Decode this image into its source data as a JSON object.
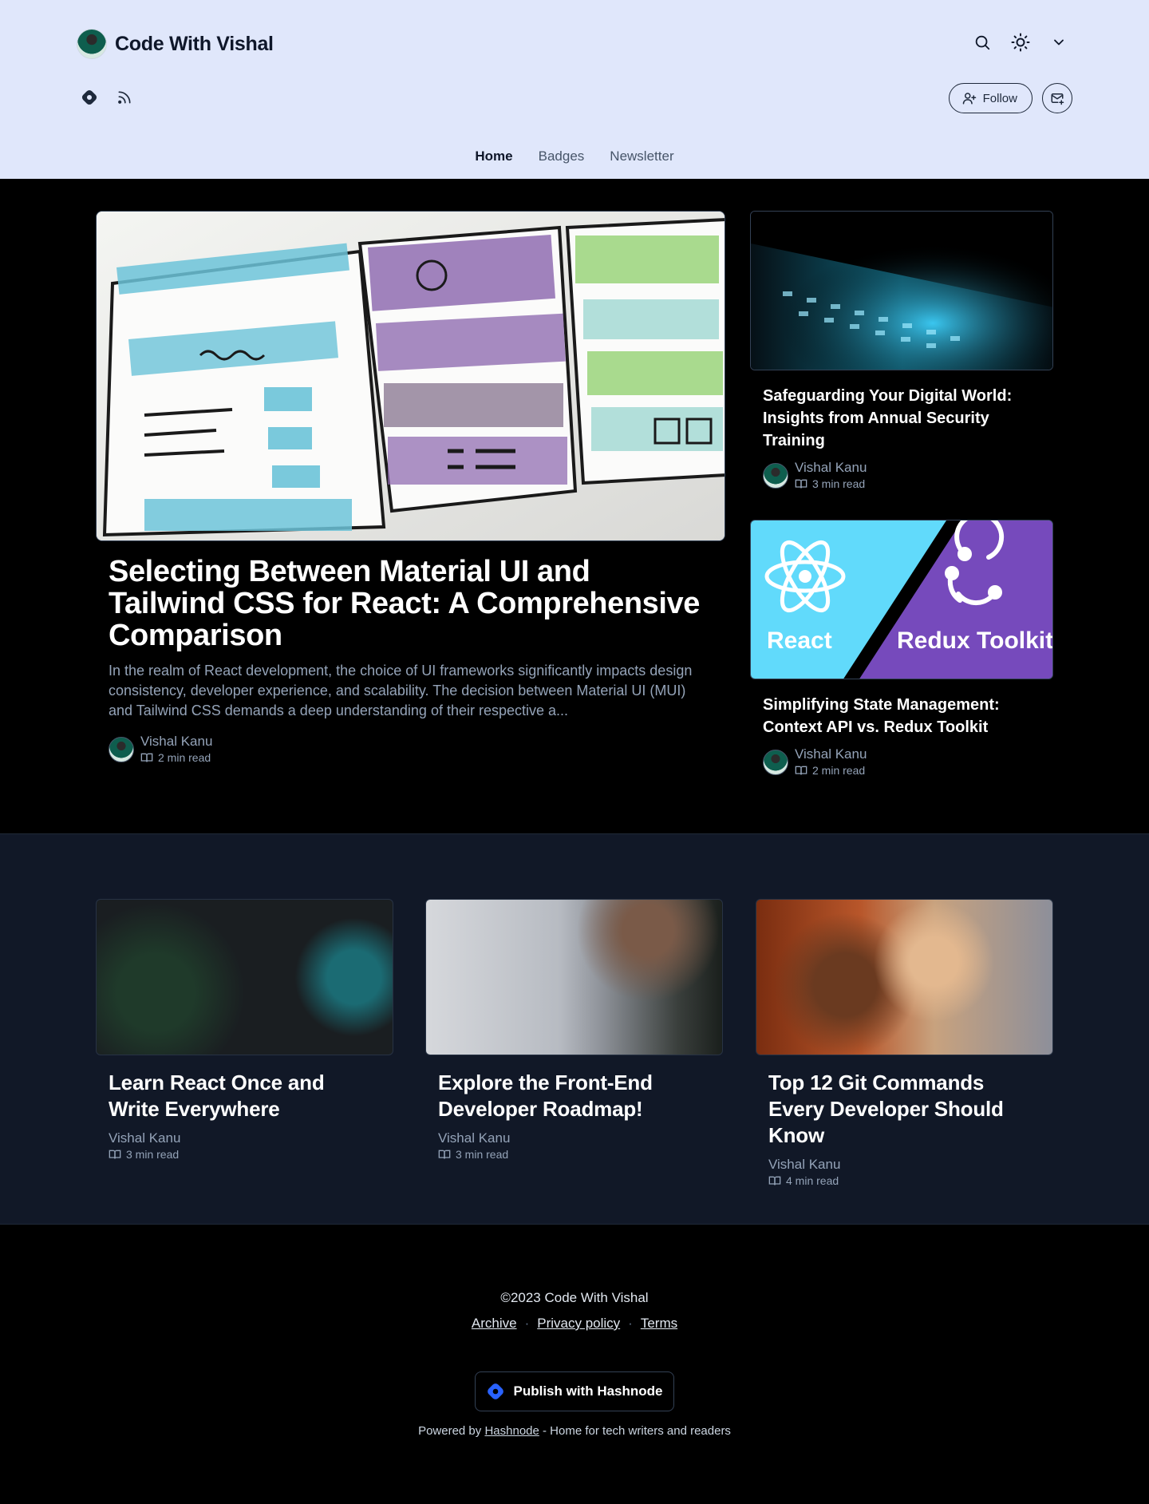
{
  "header": {
    "blog_name": "Code With Vishal",
    "actions": {
      "follow_label": "Follow"
    },
    "nav": [
      {
        "label": "Home",
        "active": true
      },
      {
        "label": "Badges",
        "active": false
      },
      {
        "label": "Newsletter",
        "active": false
      }
    ]
  },
  "featured": {
    "main": {
      "title": "Selecting Between Material UI and Tailwind CSS for React: A Comprehensive Comparison",
      "excerpt": "In the realm of React development, the choice of UI frameworks significantly impacts design consistency, developer experience, and scalability. The decision between Material UI (MUI) and Tailwind CSS demands a deep understanding of their respective a...",
      "author": "Vishal Kanu",
      "read_time": "2 min read"
    },
    "side": [
      {
        "title": "Safeguarding Your Digital World: Insights from Annual Security Training",
        "author": "Vishal Kanu",
        "read_time": "3 min read"
      },
      {
        "title": "Simplifying State Management: Context API vs. Redux Toolkit",
        "author": "Vishal Kanu",
        "read_time": "2 min read",
        "image_left_text": "React",
        "image_right_text": "Redux Toolkit"
      }
    ]
  },
  "grid": [
    {
      "title": "Learn React Once and Write Everywhere",
      "author": "Vishal Kanu",
      "read_time": "3 min read"
    },
    {
      "title": "Explore the Front-End Developer Roadmap!",
      "author": "Vishal Kanu",
      "read_time": "3 min read"
    },
    {
      "title": "Top 12 Git Commands Every Developer Should Know",
      "author": "Vishal Kanu",
      "read_time": "4 min read"
    }
  ],
  "footer": {
    "copyright": "©2023 Code With Vishal",
    "links": [
      "Archive",
      "Privacy policy",
      "Terms"
    ],
    "separator": "·",
    "publish_label": "Publish with Hashnode",
    "powered_prefix": "Powered by",
    "powered_link": "Hashnode",
    "powered_suffix": "- Home for tech writers and readers"
  },
  "colors": {
    "header_bg": "#e0e7fb",
    "featured_bg": "#000000",
    "grid_bg": "#111827",
    "muted_text": "#94a3b8",
    "hashnode_blue": "#2962ff"
  },
  "icons": [
    "search-icon",
    "sun-icon",
    "chevron-down-icon",
    "hashnode-icon",
    "rss-icon",
    "user-plus-icon",
    "mail-plus-icon",
    "book-icon"
  ]
}
